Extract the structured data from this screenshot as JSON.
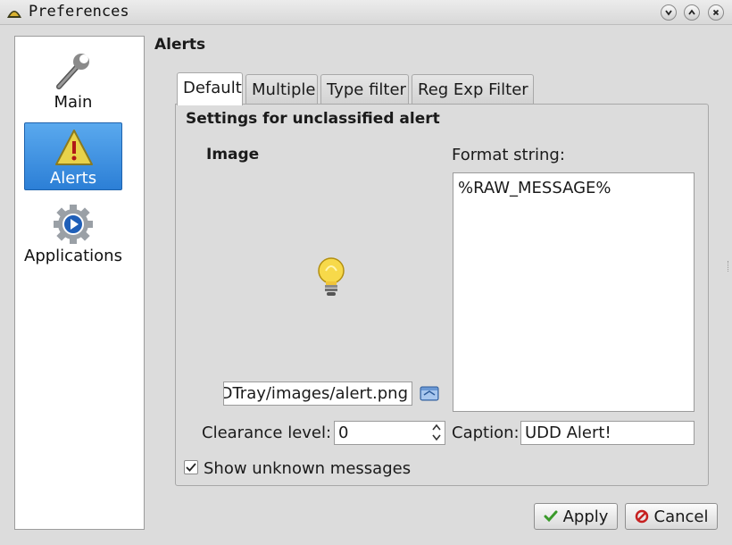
{
  "window": {
    "title": "Preferences",
    "icons": {
      "app": "udd-tray-icon",
      "minimize": "minimize-icon",
      "maximize": "maximize-icon",
      "close": "close-icon"
    }
  },
  "sidebar": {
    "items": [
      {
        "label": "Main",
        "icon": "wrench-icon",
        "active": false
      },
      {
        "label": "Alerts",
        "icon": "warning-icon",
        "active": true
      },
      {
        "label": "Applications",
        "icon": "gear-play-icon",
        "active": false
      }
    ]
  },
  "section": {
    "title": "Alerts"
  },
  "tabs": [
    {
      "label": "Default",
      "active": true
    },
    {
      "label": "Multiple",
      "active": false
    },
    {
      "label": "Type filter",
      "active": false
    },
    {
      "label": "Reg Exp Filter",
      "active": false
    }
  ],
  "panel": {
    "heading": "Settings for unclassified alert",
    "image_label": "Image",
    "image_icon": "lightbulb-icon",
    "image_path": "DDTray/images/alert.png",
    "browse_icon": "folder-open-icon",
    "format_label": "Format string:",
    "format_value": "%RAW_MESSAGE%",
    "clearance_label": "Clearance level:",
    "clearance_value": "0",
    "caption_label": "Caption:",
    "caption_value": "UDD Alert!",
    "show_unknown_label": "Show unknown messages",
    "show_unknown_checked": true
  },
  "buttons": {
    "apply": "Apply",
    "cancel": "Cancel"
  },
  "colors": {
    "selection": "#2c7fd6",
    "apply_check": "#3a9a2a",
    "cancel_icon": "#c62020"
  }
}
